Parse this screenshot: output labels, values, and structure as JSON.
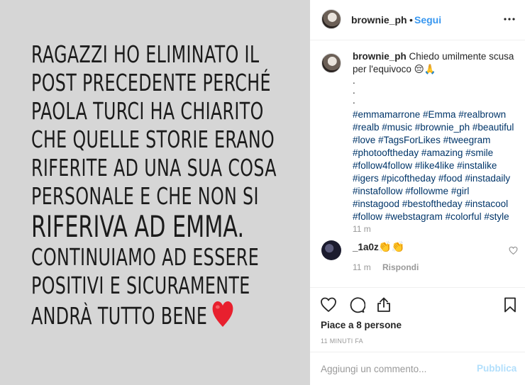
{
  "story": {
    "lines": [
      "RAGAZZI HO ELIMINATO IL",
      "POST PRECEDENTE PERCHÉ",
      "PAOLA TURCI HA CHIARITO",
      "CHE QUELLE STORIE ERANO",
      "RIFERITE AD UNA SUA COSA",
      "PERSONALE E CHE NON SI",
      "RIFERIVA AD EMMA.",
      "CONTINUIAMO AD ESSERE",
      "POSITIVI E SICURAMENTE",
      "ANDRÀ TUTTO BENE"
    ],
    "heart_color": "#e8202e"
  },
  "header": {
    "username": "brownie_ph",
    "separator": "•",
    "follow_label": "Segui",
    "more_icon": "more-horizontal-icon"
  },
  "caption": {
    "username": "brownie_ph",
    "text": "Chiedo umilmente scusa per l'equivoco 😔🙏",
    "dots": [
      ".",
      ".",
      "."
    ],
    "hashtags": "#emmamarrone #Emma #realbrown #realb #music #brownie_ph #beautiful #love #TagsForLikes #tweegram #photooftheday #amazing #smile #follow4follow #like4like #instalike #igers #picoftheday #food #instadaily #instafollow #followme #girl #instagood #bestoftheday #instacool #follow #webstagram #colorful #style",
    "time": "11 m"
  },
  "comment": {
    "username": "_1a0z",
    "text": "👏👏",
    "time": "11 m",
    "reply_label": "Rispondi"
  },
  "actions": {
    "likes": "Piace a 8 persone",
    "post_time": "11 MINUTI FA",
    "icons": [
      "heart-icon",
      "comment-icon",
      "share-icon",
      "bookmark-icon"
    ]
  },
  "add_comment": {
    "placeholder": "Aggiungi un commento...",
    "publish_label": "Pubblica"
  },
  "colors": {
    "link_blue": "#3897f0",
    "hashtag_blue": "#003569",
    "muted": "#999999",
    "publish_disabled": "#b2dffc"
  }
}
